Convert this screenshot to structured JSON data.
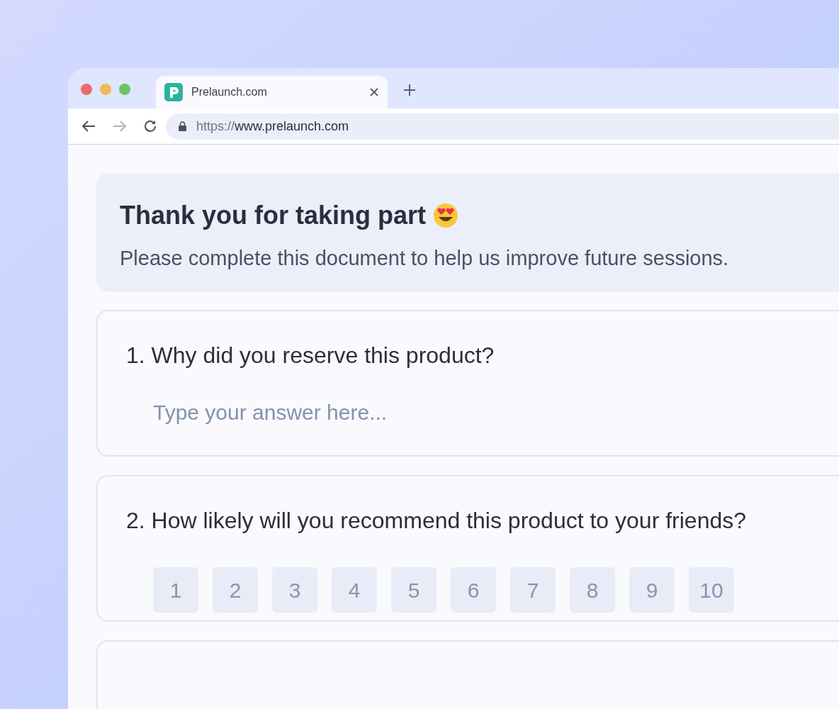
{
  "browser": {
    "tab": {
      "title": "Prelaunch.com",
      "selected": true
    },
    "url": {
      "scheme": "https://",
      "host": "www.prelaunch.com"
    }
  },
  "header": {
    "title": "Thank you for taking part",
    "subtitle": "Please complete this document to help us improve future sessions."
  },
  "questions": [
    {
      "kind": "text",
      "number": "1.",
      "text": "Why did you reserve this product?",
      "placeholder": "Type your answer here..."
    },
    {
      "kind": "rating",
      "number": "2.",
      "text": "How likely will you recommend this product to your friends?",
      "options": [
        {
          "label": "1",
          "selected": false
        },
        {
          "label": "2",
          "selected": false
        },
        {
          "label": "3",
          "selected": false
        },
        {
          "label": "4",
          "selected": false
        },
        {
          "label": "5",
          "selected": false
        },
        {
          "label": "6",
          "selected": false
        },
        {
          "label": "7",
          "selected": false
        },
        {
          "label": "8",
          "selected": false
        },
        {
          "label": "9",
          "selected": false
        },
        {
          "label": "10",
          "selected": false
        }
      ]
    },
    {
      "kind": "empty"
    }
  ]
}
